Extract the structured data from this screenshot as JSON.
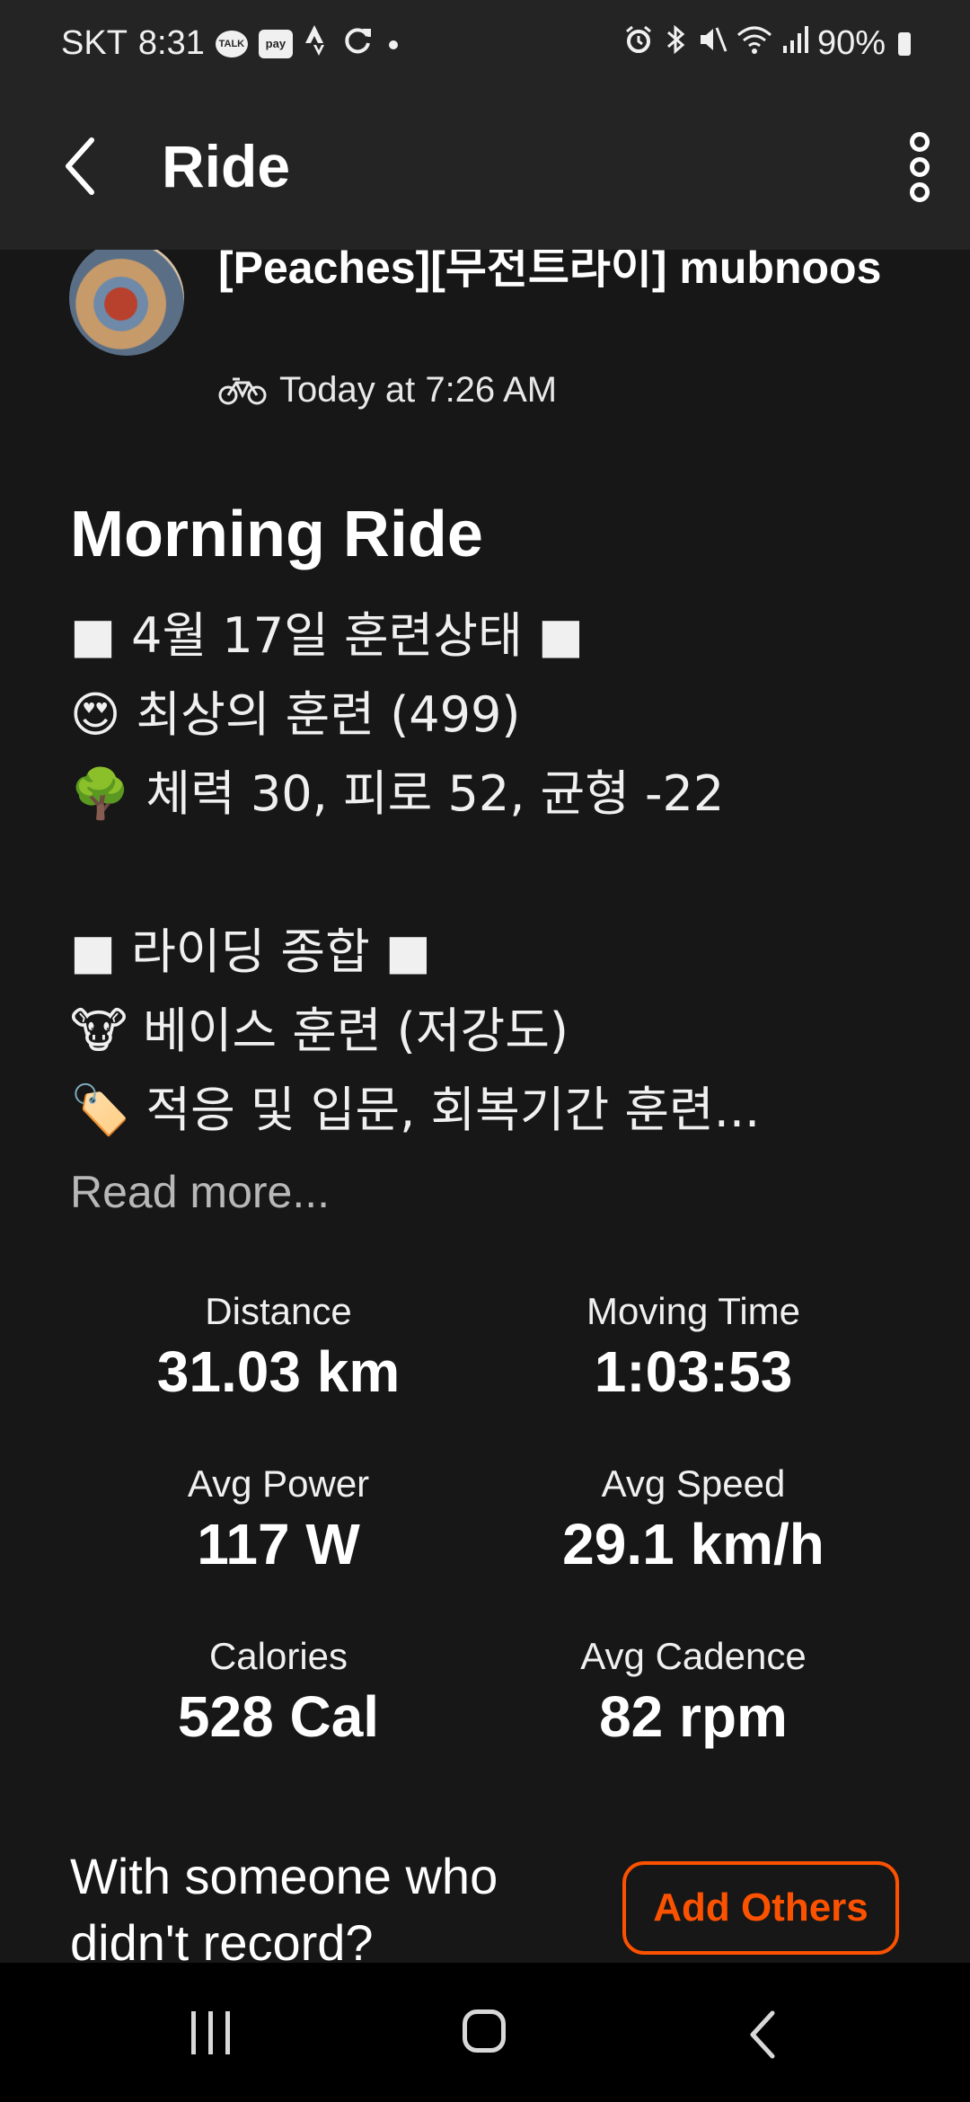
{
  "status_bar": {
    "carrier": "SKT",
    "time": "8:31",
    "talk_icon_text": "TALK",
    "pay_icon_text": "pay",
    "battery": "90%"
  },
  "app_bar": {
    "title": "Ride"
  },
  "athlete": {
    "name": "[Peaches][무전트라이] mubnoos",
    "date": "Today at 7:26 AM"
  },
  "activity": {
    "title": "Morning Ride",
    "description": "■ 4월 17일 훈련상태 ■\n😍 최상의 훈련 (499)\n🌳 체력 30, 피로 52, 균형 -22\n\n■ 라이딩 종합 ■\n🐮 베이스 훈련 (저강도)\n🏷️ 적응 및 입문, 회복기간 훈련...",
    "read_more": "Read more..."
  },
  "stats": [
    {
      "label": "Distance",
      "value": "31.03 km"
    },
    {
      "label": "Moving Time",
      "value": "1:03:53"
    },
    {
      "label": "Avg Power",
      "value": "117 W"
    },
    {
      "label": "Avg Speed",
      "value": "29.1 km/h"
    },
    {
      "label": "Calories",
      "value": "528 Cal"
    },
    {
      "label": "Avg Cadence",
      "value": "82 rpm"
    }
  ],
  "with_others": {
    "text": "With someone who didn't record?",
    "button": "Add Others"
  },
  "colors": {
    "accent": "#fc5200",
    "background": "#171717",
    "bar": "#242424"
  }
}
